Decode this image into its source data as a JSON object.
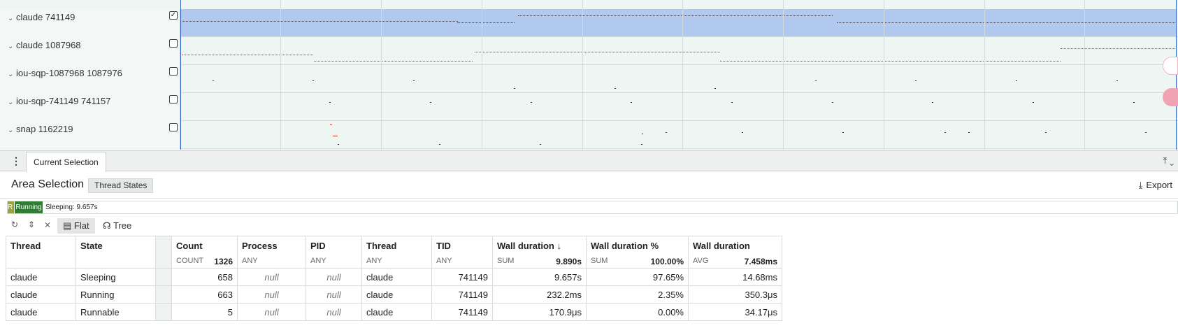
{
  "tracks": [
    {
      "name": "claude 741149",
      "checked": true
    },
    {
      "name": "claude 1087968",
      "checked": false
    },
    {
      "name": "iou-sqp-1087968 1087976",
      "checked": false
    },
    {
      "name": "iou-sqp-741149 741157",
      "checked": false
    },
    {
      "name": "snap 1162219",
      "checked": false
    }
  ],
  "icons": {
    "chevron": "chevron-down-icon",
    "checked": "checked-box-icon",
    "unchecked": "unchecked-box-icon"
  },
  "colors": {
    "selection": "#b1c9ef",
    "running": "#2f7d33",
    "runnable": "#98a33a",
    "accent": "#2e63c7"
  },
  "tab": {
    "label": "Current Selection"
  },
  "panel": {
    "title": "Area Selection",
    "chip": "Thread States",
    "export_label": "Export"
  },
  "statebar": {
    "runnable_label": "R",
    "running_label": "Running",
    "sleeping_label": "Sleeping: 9.657s"
  },
  "toolbar": {
    "flat_label": "Flat",
    "tree_label": "Tree"
  },
  "table": {
    "columns": {
      "thread": "Thread",
      "state": "State",
      "count": "Count",
      "process": "Process",
      "pid": "PID",
      "thread2": "Thread",
      "tid": "TID",
      "wall": "Wall duration",
      "wall_pct": "Wall duration %",
      "wall_avg": "Wall duration"
    },
    "aggregates": {
      "count_label": "COUNT",
      "count_value": "1326",
      "process_label": "ANY",
      "pid_label": "ANY",
      "thread_label": "ANY",
      "tid_label": "ANY",
      "wall_label": "SUM",
      "wall_value": "9.890s",
      "pct_label": "SUM",
      "pct_value": "100.00%",
      "avg_label": "AVG",
      "avg_value": "7.458ms"
    },
    "rows": [
      {
        "thread": "claude",
        "state": "Sleeping",
        "count": "658",
        "process": "null",
        "pid": "null",
        "thread2": "claude",
        "tid": "741149",
        "wall": "9.657s",
        "pct": "97.65%",
        "avg": "14.68ms"
      },
      {
        "thread": "claude",
        "state": "Running",
        "count": "663",
        "process": "null",
        "pid": "null",
        "thread2": "claude",
        "tid": "741149",
        "wall": "232.2ms",
        "pct": "2.35%",
        "avg": "350.3μs"
      },
      {
        "thread": "claude",
        "state": "Runnable",
        "count": "5",
        "process": "null",
        "pid": "null",
        "thread2": "claude",
        "tid": "741149",
        "wall": "170.9μs",
        "pct": "0.00%",
        "avg": "34.17μs"
      }
    ]
  }
}
